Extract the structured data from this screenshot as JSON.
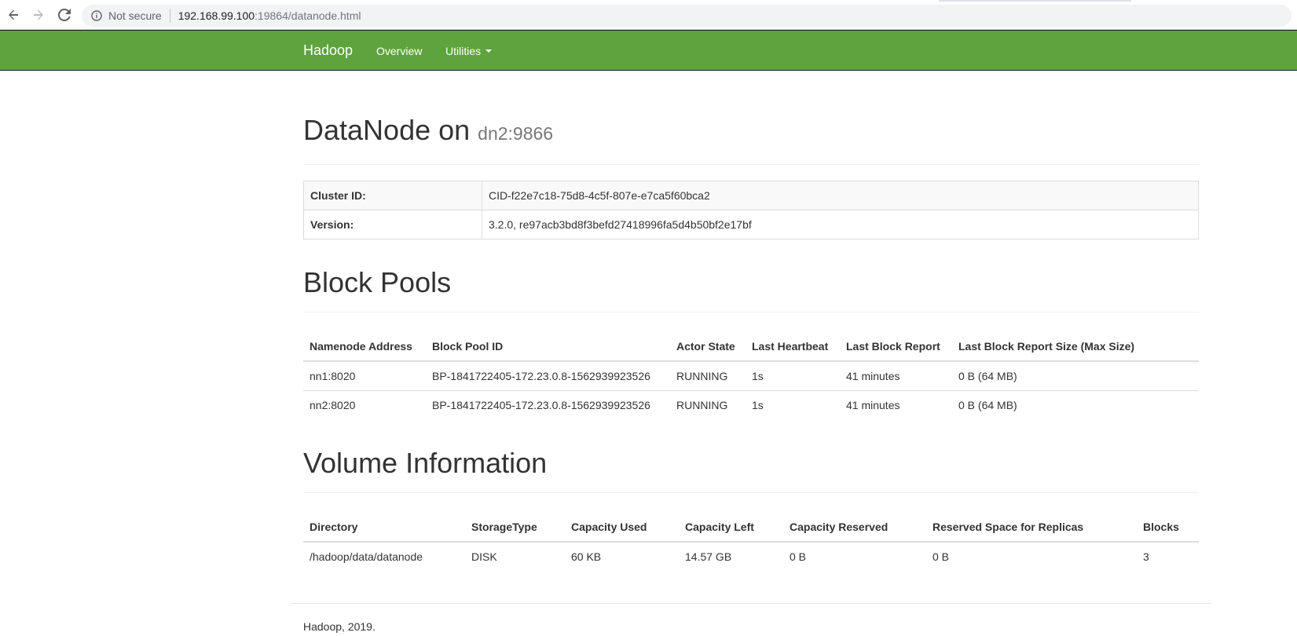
{
  "browser": {
    "security_label": "Not secure",
    "url_host": "192.168.99.100",
    "url_rest": ":19864/datanode.html"
  },
  "navbar": {
    "brand": "Hadoop",
    "links": [
      "Overview",
      "Utilities"
    ],
    "color": "#5fa33e"
  },
  "header": {
    "title": "DataNode on",
    "host": "dn2:9866"
  },
  "info": [
    {
      "key": "Cluster ID:",
      "value": "CID-f22e7c18-75d8-4c5f-807e-e7ca5f60bca2"
    },
    {
      "key": "Version:",
      "value": "3.2.0, re97acb3bd8f3befd27418996fa5d4b50bf2e17bf"
    }
  ],
  "block_pools": {
    "title": "Block Pools",
    "columns": [
      "Namenode Address",
      "Block Pool ID",
      "Actor State",
      "Last Heartbeat",
      "Last Block Report",
      "Last Block Report Size (Max Size)"
    ],
    "rows": [
      [
        "nn1:8020",
        "BP-1841722405-172.23.0.8-1562939923526",
        "RUNNING",
        "1s",
        "41 minutes",
        "0 B (64 MB)"
      ],
      [
        "nn2:8020",
        "BP-1841722405-172.23.0.8-1562939923526",
        "RUNNING",
        "1s",
        "41 minutes",
        "0 B (64 MB)"
      ]
    ]
  },
  "volumes": {
    "title": "Volume Information",
    "columns": [
      "Directory",
      "StorageType",
      "Capacity Used",
      "Capacity Left",
      "Capacity Reserved",
      "Reserved Space for Replicas",
      "Blocks"
    ],
    "rows": [
      [
        "/hadoop/data/datanode",
        "DISK",
        "60 KB",
        "14.57 GB",
        "0 B",
        "0 B",
        "3"
      ]
    ]
  },
  "footer": "Hadoop, 2019."
}
